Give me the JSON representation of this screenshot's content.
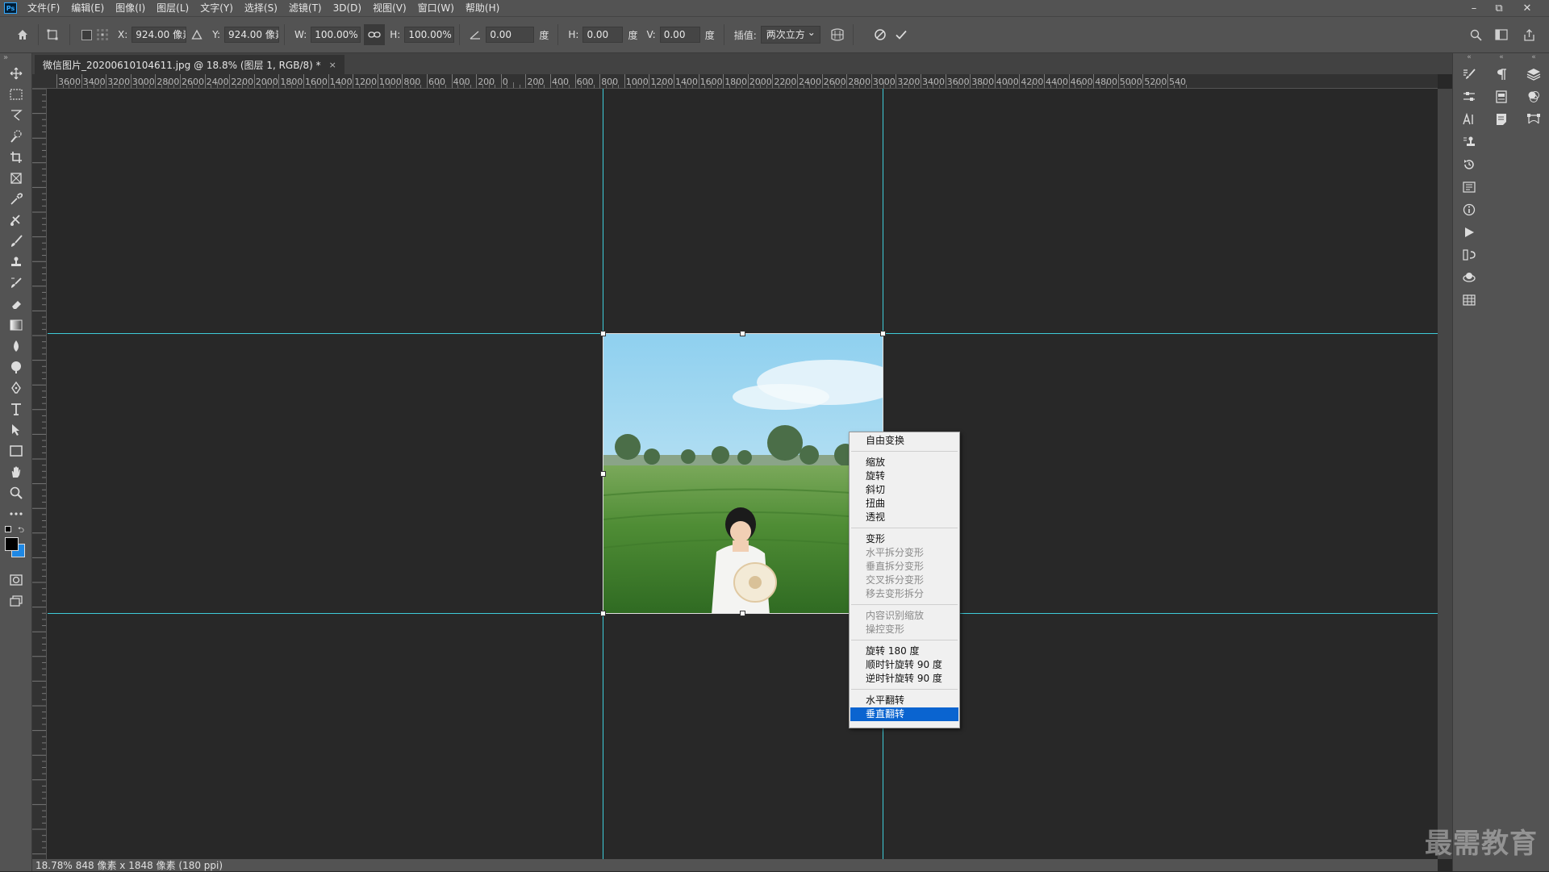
{
  "app": {
    "logo": "Ps"
  },
  "menu": [
    "文件(F)",
    "编辑(E)",
    "图像(I)",
    "图层(L)",
    "文字(Y)",
    "选择(S)",
    "滤镜(T)",
    "3D(D)",
    "视图(V)",
    "窗口(W)",
    "帮助(H)"
  ],
  "window_controls": {
    "minimize": "–",
    "restore": "⧉",
    "close": "✕"
  },
  "options": {
    "x_label": "X:",
    "x_value": "924.00 像素",
    "y_label": "Y:",
    "y_value": "924.00 像素",
    "w_label": "W:",
    "w_value": "100.00%",
    "h_label": "H:",
    "h_value": "100.00%",
    "angle_value": "0.00",
    "angle_unit": "度",
    "hskew_label": "H:",
    "hskew_value": "0.00",
    "hskew_unit": "度",
    "vskew_label": "V:",
    "vskew_value": "0.00",
    "vskew_unit": "度",
    "interp_label": "插值:",
    "interp_value": "两次立方"
  },
  "document_tab": {
    "title": "微信图片_20200610104611.jpg @ 18.8% (图层 1, RGB/8) *",
    "close": "×"
  },
  "ruler_top": [
    "3600",
    "3400",
    "3200",
    "3000",
    "2800",
    "2600",
    "2400",
    "2200",
    "2000",
    "1800",
    "1600",
    "1400",
    "1200",
    "1000",
    "800",
    "600",
    "400",
    "200",
    "0",
    "200",
    "400",
    "600",
    "800",
    "1000",
    "1200",
    "1400",
    "1600",
    "1800",
    "2000",
    "2200",
    "2400",
    "2600",
    "2800",
    "3000",
    "3200",
    "3400",
    "3600",
    "3800",
    "4000",
    "4200",
    "4400",
    "4600",
    "4800",
    "5000",
    "5200",
    "540"
  ],
  "context_menu": {
    "groups": [
      [
        {
          "label": "自由变换",
          "enabled": true
        }
      ],
      [
        {
          "label": "缩放",
          "enabled": true
        },
        {
          "label": "旋转",
          "enabled": true
        },
        {
          "label": "斜切",
          "enabled": true
        },
        {
          "label": "扭曲",
          "enabled": true
        },
        {
          "label": "透视",
          "enabled": true
        }
      ],
      [
        {
          "label": "变形",
          "enabled": true
        },
        {
          "label": "水平拆分变形",
          "enabled": false
        },
        {
          "label": "垂直拆分变形",
          "enabled": false
        },
        {
          "label": "交叉拆分变形",
          "enabled": false
        },
        {
          "label": "移去变形拆分",
          "enabled": false
        }
      ],
      [
        {
          "label": "内容识别缩放",
          "enabled": false
        },
        {
          "label": "操控变形",
          "enabled": false
        }
      ],
      [
        {
          "label": "旋转 180 度",
          "enabled": true
        },
        {
          "label": "顺时针旋转 90 度",
          "enabled": true
        },
        {
          "label": "逆时针旋转 90 度",
          "enabled": true
        }
      ],
      [
        {
          "label": "水平翻转",
          "enabled": true
        },
        {
          "label": "垂直翻转",
          "enabled": true,
          "highlighted": true
        }
      ]
    ]
  },
  "status": {
    "zoom": "18.78%",
    "doc_size": "848 像素 x 1848 像素 (180 ppi)"
  },
  "watermark": "最需教育",
  "colors": {
    "guide": "#3ecbd8",
    "highlight": "#0a64d0",
    "foreground": "#000000",
    "background": "#1e88e5"
  }
}
